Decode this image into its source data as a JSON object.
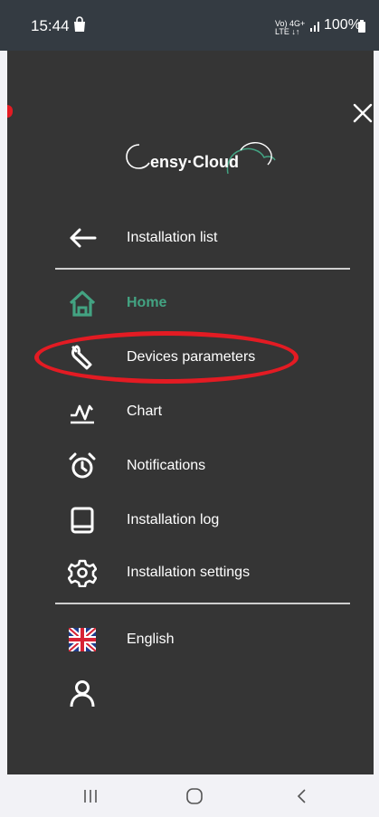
{
  "status_bar": {
    "time": "15:44",
    "network_line1": "Vo) 4G+",
    "network_line2": "LTE ↓↑",
    "battery": "100%"
  },
  "app": {
    "logo_text": "ensy·Cloud",
    "close_icon": "close-icon"
  },
  "menu": {
    "back": {
      "label": "Installation list",
      "icon": "arrow-left-icon"
    },
    "items": [
      {
        "label": "Home",
        "icon": "home-icon",
        "active": true
      },
      {
        "label": "Devices parameters",
        "icon": "wrench-icon",
        "active": false
      },
      {
        "label": "Chart",
        "icon": "chart-icon",
        "active": false
      },
      {
        "label": "Notifications",
        "icon": "alarm-clock-icon",
        "active": false
      },
      {
        "label": "Installation log",
        "icon": "book-icon",
        "active": false
      },
      {
        "label": "Installation settings",
        "icon": "gear-icon",
        "active": false
      }
    ],
    "language": {
      "label": "English",
      "icon": "uk-flag-icon"
    },
    "user": {
      "icon": "user-icon"
    }
  },
  "colors": {
    "drawer_bg": "#353535",
    "status_bg": "#343b42",
    "active": "#43a382",
    "annotation": "#e31b23"
  },
  "nav_bar": {
    "icons": [
      "recent-apps-icon",
      "home-button-icon",
      "back-icon"
    ]
  }
}
